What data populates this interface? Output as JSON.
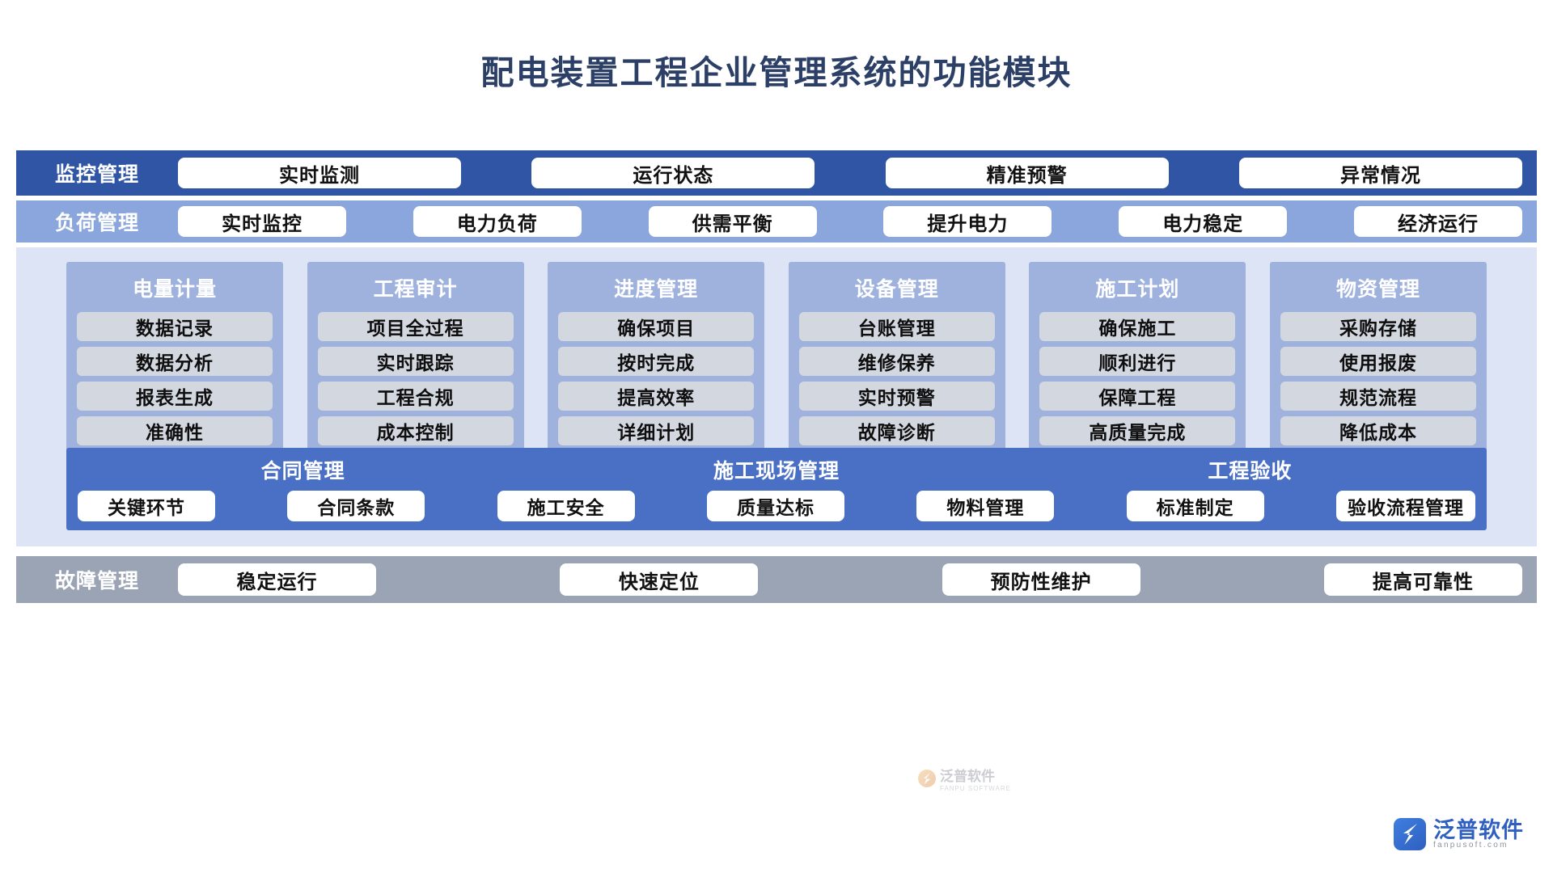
{
  "title": "配电装置工程企业管理系统的功能模块",
  "colors": {
    "title_text": "#2c3f66",
    "row_monitor_bg": "#2f55a4",
    "row_load_bg": "#8ba6dd",
    "middle_bg": "#dde4f5",
    "column_bg": "#9fb2dd",
    "column_item_bg": "#d3d8e0",
    "contract_bg": "#4a70c6",
    "row_fault_bg": "#9ba4b4",
    "pill_bg": "#ffffff",
    "brand_blue": "#2f5fc0"
  },
  "rows": {
    "monitor": {
      "label": "监控管理",
      "items": [
        "实时监测",
        "运行状态",
        "精准预警",
        "异常情况"
      ]
    },
    "load": {
      "label": "负荷管理",
      "items": [
        "实时监控",
        "电力负荷",
        "供需平衡",
        "提升电力",
        "电力稳定",
        "经济运行"
      ]
    },
    "fault": {
      "label": "故障管理",
      "items": [
        "稳定运行",
        "快速定位",
        "预防性维护",
        "提高可靠性"
      ]
    }
  },
  "columns": [
    {
      "title": "电量计量",
      "items": [
        "数据记录",
        "数据分析",
        "报表生成",
        "准确性"
      ]
    },
    {
      "title": "工程审计",
      "items": [
        "项目全过程",
        "实时跟踪",
        "工程合规",
        "成本控制"
      ]
    },
    {
      "title": "进度管理",
      "items": [
        "确保项目",
        "按时完成",
        "提高效率",
        "详细计划"
      ]
    },
    {
      "title": "设备管理",
      "items": [
        "台账管理",
        "维修保养",
        "实时预警",
        "故障诊断"
      ]
    },
    {
      "title": "施工计划",
      "items": [
        "确保施工",
        "顺利进行",
        "保障工程",
        "高质量完成"
      ]
    },
    {
      "title": "物资管理",
      "items": [
        "采购存储",
        "使用报废",
        "规范流程",
        "降低成本"
      ]
    }
  ],
  "contract_band": {
    "headings": [
      "合同管理",
      "施工现场管理",
      "工程验收"
    ],
    "items": [
      "关键环节",
      "合同条款",
      "施工安全",
      "质量达标",
      "物料管理",
      "标准制定",
      "验收流程管理"
    ]
  },
  "watermark": {
    "text": "泛普软件",
    "sub": "FANPU SOFTWARE"
  },
  "logo": {
    "name": "泛普软件",
    "sub": "fanpusoft.com"
  }
}
